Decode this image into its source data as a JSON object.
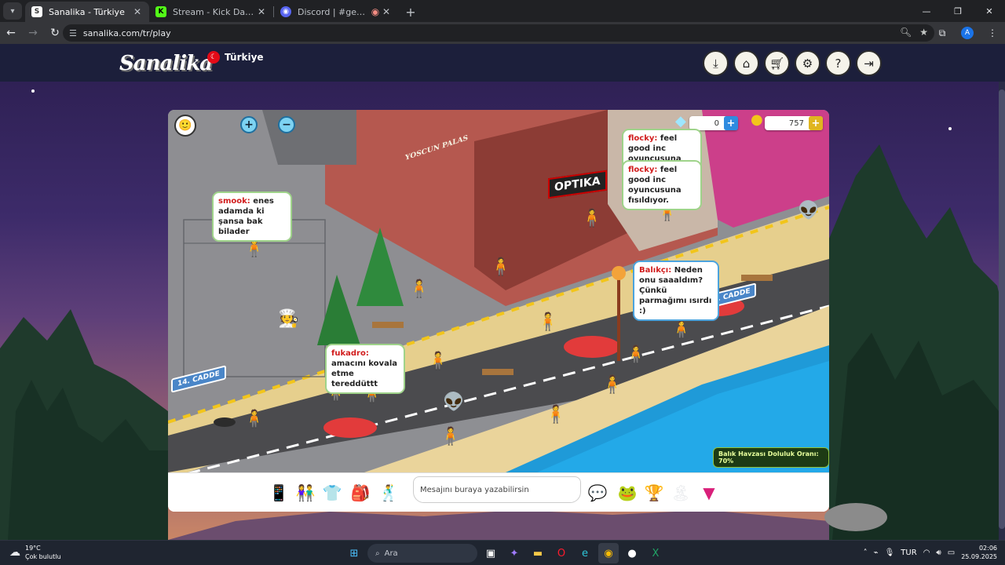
{
  "browser": {
    "tabs": [
      {
        "title": "Sanalika - Türkiye",
        "active": true,
        "favicon_color": "#ffffff"
      },
      {
        "title": "Stream - Kick Dashboard",
        "active": false,
        "favicon_color": "#53fc18"
      },
      {
        "title": "Discord | #genel | Durum B",
        "active": false,
        "favicon_color": "#5865f2"
      }
    ],
    "url": "sanalika.com/tr/play",
    "profile_initial": "A"
  },
  "site": {
    "logo": "Sanalika",
    "region": "Türkiye",
    "nav_icons": [
      "download-icon",
      "home-icon",
      "cart-icon",
      "settings-icon",
      "help-icon",
      "logout-icon"
    ]
  },
  "game": {
    "diamonds": "0",
    "coins": "757",
    "street_signs": [
      "3. CADDE",
      "14. CADDE"
    ],
    "shop_sign": "YOSCUN PALAS",
    "optika_sign": "OPTIKA",
    "chat_bubbles": [
      {
        "nick": "flocky:",
        "text": "feel good inc oyuncusuna fısıldıyor."
      },
      {
        "nick": "flocky:",
        "text": "feel good inc oyuncusuna fısıldıyor."
      },
      {
        "nick": "smook:",
        "text": "enes adamda ki şansa bak bilader"
      },
      {
        "nick": "Balıkçı:",
        "text": "Neden onu saaaldım? Çünkü parmağımı ısırdı :)"
      },
      {
        "nick": "fukadro:",
        "text": "amacını kovala etme tereddüttt"
      }
    ],
    "fish_status": "Balık Havzası Doluluk Oranı: 70%",
    "chat_placeholder": "Mesajını buraya yazabilirsin"
  },
  "taskbar": {
    "weather_temp": "19°C",
    "weather_desc": "Çok bulutlu",
    "search_label": "Ara",
    "lang": "TUR",
    "time": "02:06",
    "date": "25.09.2025"
  }
}
